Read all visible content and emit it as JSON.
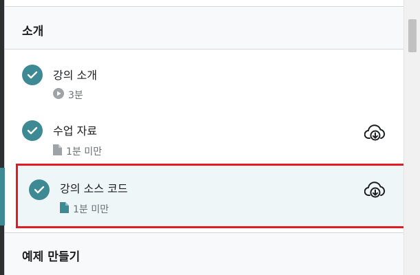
{
  "sections": [
    {
      "title": "소개",
      "items": [
        {
          "name": "강의 소개",
          "meta": "3분",
          "meta_icon": "play-icon",
          "completed": true,
          "has_download": false
        },
        {
          "name": "수업 자료",
          "meta": "1분 미만",
          "meta_icon": "file-icon",
          "completed": true,
          "has_download": true
        },
        {
          "name": "강의 소스 코드",
          "meta": "1분 미만",
          "meta_icon": "file-icon",
          "completed": true,
          "has_download": true,
          "active": true
        }
      ]
    },
    {
      "title": "예제 만들기"
    }
  ],
  "colors": {
    "accent": "#3d8a94",
    "highlight_border": "#e01b24",
    "active_bg": "#eef6f7"
  }
}
